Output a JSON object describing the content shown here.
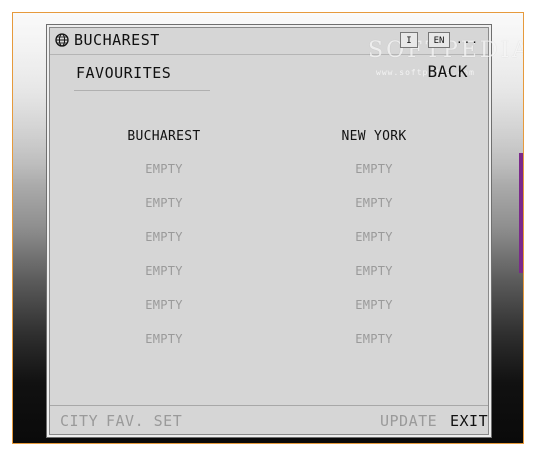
{
  "window": {
    "city_title": "BUCHAREST",
    "info_btn": "I",
    "lang_btn": "EN",
    "more_btn": "..."
  },
  "watermark": {
    "brand": "SOFTPEDIA",
    "url": "www.softpedia.com"
  },
  "header": {
    "favourites": "FAVOURITES",
    "back": "BACK"
  },
  "columns": [
    {
      "city": "BUCHAREST",
      "slots": [
        "EMPTY",
        "EMPTY",
        "EMPTY",
        "EMPTY",
        "EMPTY",
        "EMPTY"
      ]
    },
    {
      "city": "NEW YORK",
      "slots": [
        "EMPTY",
        "EMPTY",
        "EMPTY",
        "EMPTY",
        "EMPTY",
        "EMPTY"
      ]
    }
  ],
  "bottom": {
    "city": "CITY",
    "fav_set": "FAV. SET",
    "update": "UPDATE",
    "exit": "EXIT"
  },
  "icons": {
    "globe": "globe-icon"
  },
  "colors": {
    "panel": "#d6d6d6",
    "frame_border": "#e69a3c",
    "disabled_text": "#9a9a9a"
  }
}
